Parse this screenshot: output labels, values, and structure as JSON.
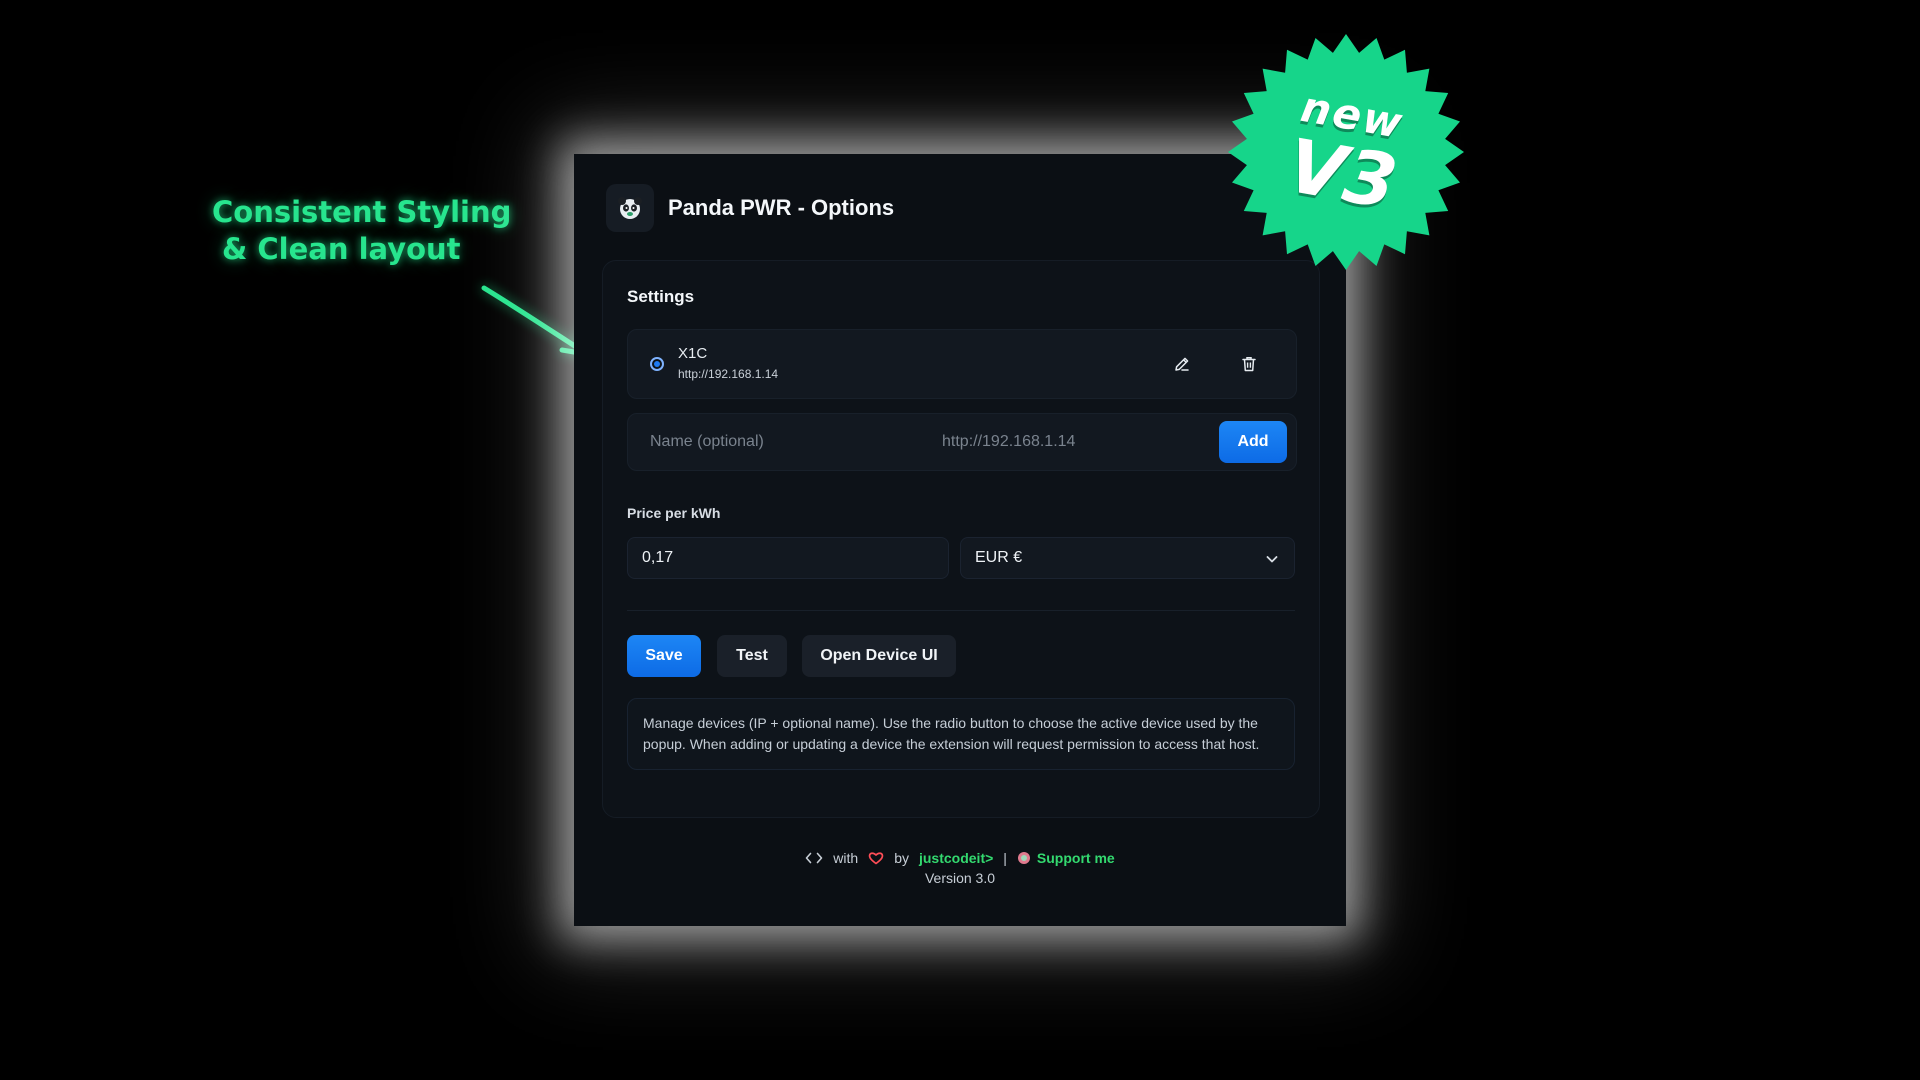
{
  "callout": {
    "line1": "Consistent Styling",
    "line2": "& Clean layout"
  },
  "badge": {
    "line1": "new",
    "line2": "V3",
    "color": "#16d58a"
  },
  "window": {
    "title": "Panda PWR - Options",
    "logo_icon": "panda-logo-icon"
  },
  "settings": {
    "title": "Settings",
    "devices": [
      {
        "name": "X1C",
        "url": "http://192.168.1.14",
        "selected": true
      }
    ],
    "add_form": {
      "name_placeholder": "Name (optional)",
      "url_placeholder": "http://192.168.1.14",
      "add_label": "Add"
    },
    "price": {
      "label": "Price per kWh",
      "value": "0,17",
      "currency": "EUR €"
    },
    "actions": {
      "save_label": "Save",
      "test_label": "Test",
      "open_ui_label": "Open Device UI"
    },
    "info": "Manage devices (IP + optional name). Use the radio button to choose the active device used by the popup. When adding or updating a device the extension will request permission to access that host."
  },
  "footer": {
    "with": "with",
    "by": "by",
    "author": "justcodeit>",
    "separator": "|",
    "support": "Support me",
    "version": "Version 3.0"
  },
  "colors": {
    "accent_green": "#27e58e",
    "primary_blue": "#1277ee",
    "window_bg": "#0b0f14"
  }
}
